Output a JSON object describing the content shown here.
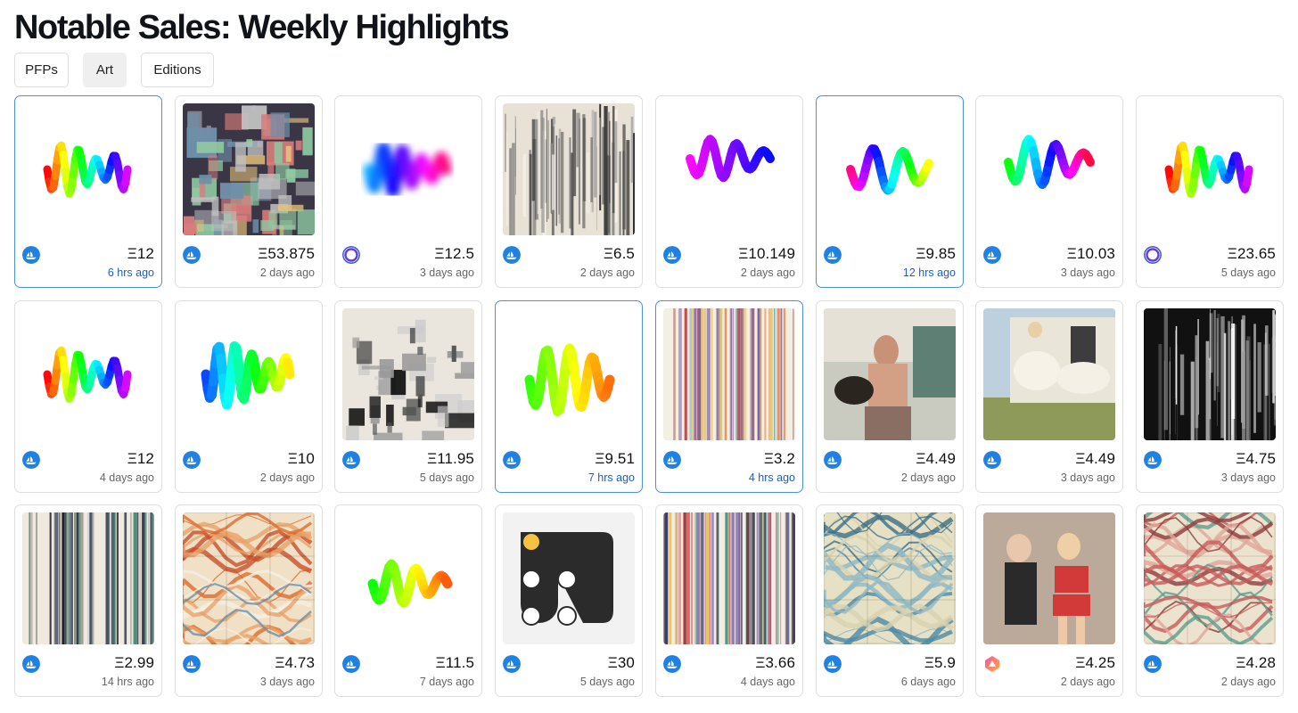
{
  "page": {
    "title": "Notable Sales: Weekly Highlights"
  },
  "tabs": [
    {
      "label": "PFPs",
      "active": false
    },
    {
      "label": "Art",
      "active": true
    },
    {
      "label": "Editions",
      "active": false
    }
  ],
  "colors": {
    "recent_border": "#4a90e2",
    "recent_time": "#1a5fc0",
    "opensea_blue": "#2081e2",
    "card_border": "#dedede"
  },
  "cards": [
    {
      "price": "Ξ12",
      "time": "6 hrs ago",
      "recent": true,
      "marketplace": "opensea-icon",
      "art": "rainbow-squiggle-art"
    },
    {
      "price": "Ξ53.875",
      "time": "2 days ago",
      "recent": false,
      "marketplace": "opensea-icon",
      "art": "dark-flowfield-art"
    },
    {
      "price": "Ξ12.5",
      "time": "3 days ago",
      "recent": false,
      "marketplace": "rarible-ring-icon",
      "art": "blurred-squiggle-art"
    },
    {
      "price": "Ξ6.5",
      "time": "2 days ago",
      "recent": false,
      "marketplace": "opensea-icon",
      "art": "monochrome-landscape-art"
    },
    {
      "price": "Ξ10.149",
      "time": "2 days ago",
      "recent": false,
      "marketplace": "opensea-icon",
      "art": "purple-squiggle-art"
    },
    {
      "price": "Ξ9.85",
      "time": "12 hrs ago",
      "recent": true,
      "marketplace": "opensea-icon",
      "art": "red-orange-squiggle-art"
    },
    {
      "price": "Ξ10.03",
      "time": "3 days ago",
      "recent": false,
      "marketplace": "opensea-icon",
      "art": "green-red-squiggle-art"
    },
    {
      "price": "Ξ23.65",
      "time": "5 days ago",
      "recent": false,
      "marketplace": "rarible-ring-icon",
      "art": "rainbow-squiggle-art"
    },
    {
      "price": "Ξ12",
      "time": "4 days ago",
      "recent": false,
      "marketplace": "opensea-icon",
      "art": "rainbow-squiggle-art"
    },
    {
      "price": "Ξ10",
      "time": "2 days ago",
      "recent": false,
      "marketplace": "opensea-icon",
      "art": "blue-green-squiggle-art"
    },
    {
      "price": "Ξ11.95",
      "time": "5 days ago",
      "recent": false,
      "marketplace": "opensea-icon",
      "art": "grayscale-collage-art"
    },
    {
      "price": "Ξ9.51",
      "time": "7 hrs ago",
      "recent": true,
      "marketplace": "opensea-icon",
      "art": "green-squiggle-art"
    },
    {
      "price": "Ξ3.2",
      "time": "4 hrs ago",
      "recent": true,
      "marketplace": "opensea-icon",
      "art": "pastel-streaks-art"
    },
    {
      "price": "Ξ4.49",
      "time": "2 days ago",
      "recent": false,
      "marketplace": "opensea-icon",
      "art": "vintage-photo-art"
    },
    {
      "price": "Ξ4.49",
      "time": "3 days ago",
      "recent": false,
      "marketplace": "opensea-icon",
      "art": "dancing-women-photo-art"
    },
    {
      "price": "Ξ4.75",
      "time": "3 days ago",
      "recent": false,
      "marketplace": "opensea-icon",
      "art": "dark-splash-art"
    },
    {
      "price": "Ξ2.99",
      "time": "14 hrs ago",
      "recent": false,
      "marketplace": "opensea-icon",
      "art": "vertical-lines-art"
    },
    {
      "price": "Ξ4.73",
      "time": "3 days ago",
      "recent": false,
      "marketplace": "opensea-icon",
      "art": "orange-marble-art"
    },
    {
      "price": "Ξ11.5",
      "time": "7 days ago",
      "recent": false,
      "marketplace": "opensea-icon",
      "art": "green-orange-squiggle-art"
    },
    {
      "price": "Ξ30",
      "time": "5 days ago",
      "recent": false,
      "marketplace": "opensea-icon",
      "art": "dots-glyph-art"
    },
    {
      "price": "Ξ3.66",
      "time": "4 days ago",
      "recent": false,
      "marketplace": "opensea-icon",
      "art": "watercolor-drip-art"
    },
    {
      "price": "Ξ5.9",
      "time": "6 days ago",
      "recent": false,
      "marketplace": "opensea-icon",
      "art": "blue-marble-tiles-art"
    },
    {
      "price": "Ξ4.25",
      "time": "2 days ago",
      "recent": false,
      "marketplace": "foundation-icon",
      "art": "pinup-photo-art"
    },
    {
      "price": "Ξ4.28",
      "time": "2 days ago",
      "recent": false,
      "marketplace": "opensea-icon",
      "art": "red-marble-tiles-art"
    }
  ]
}
